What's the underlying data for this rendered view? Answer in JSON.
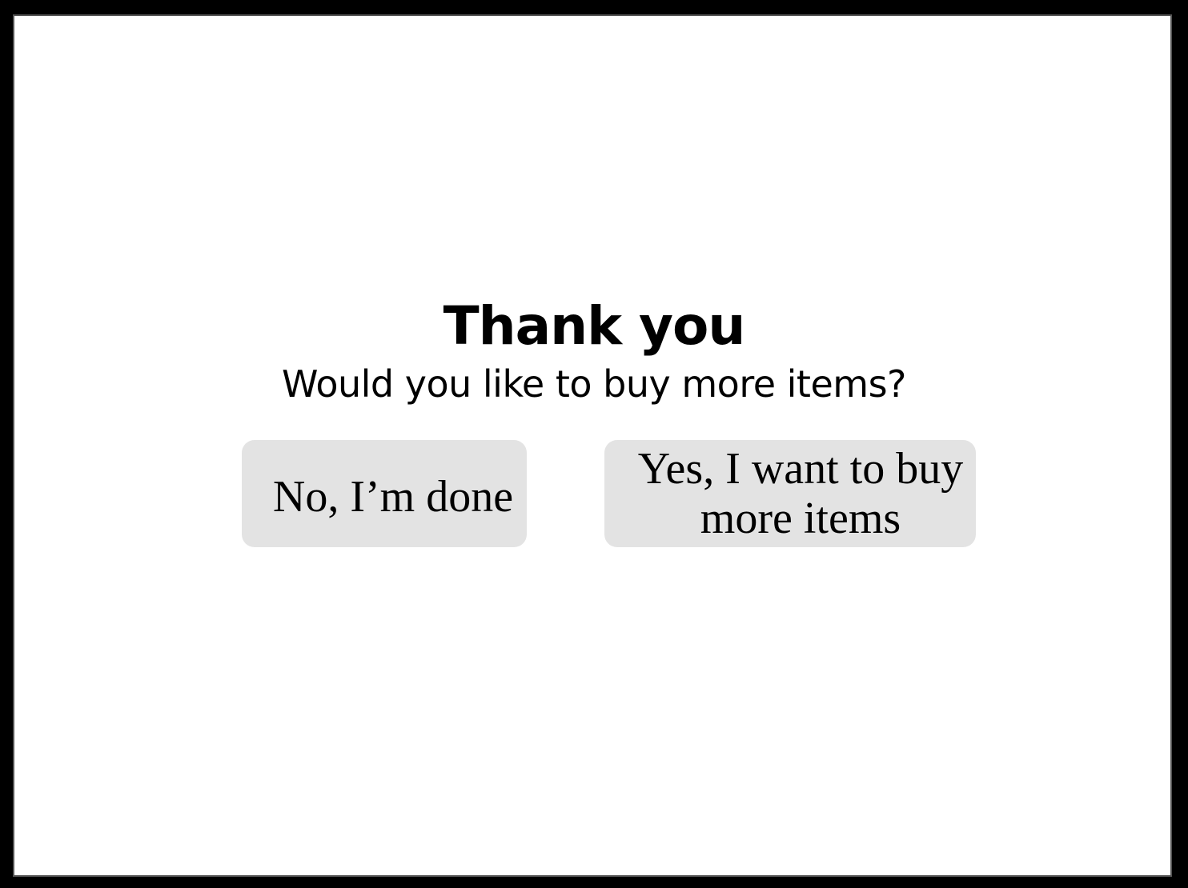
{
  "dialog": {
    "title": "Thank you",
    "subtitle": "Would you like to buy more items?",
    "no_button_label": "No, I’m done",
    "yes_button_label": "Yes, I want to buy more items"
  },
  "colors": {
    "background": "#ffffff",
    "frame": "#000000",
    "button_background": "#e3e3e3",
    "text": "#000000"
  }
}
